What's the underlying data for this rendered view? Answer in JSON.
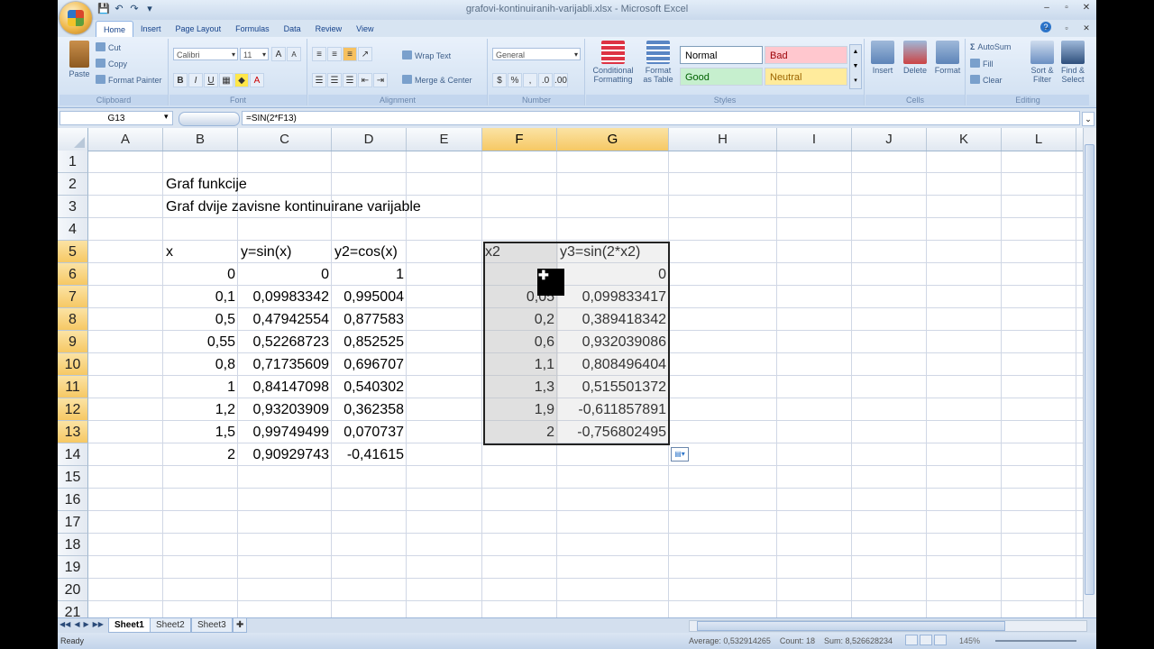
{
  "window": {
    "title": "grafovi-kontinuiranih-varijabli.xlsx - Microsoft Excel",
    "controls": [
      "‒",
      "▫",
      "✕"
    ]
  },
  "qat": {
    "save": "💾",
    "undo": "↶",
    "redo": "↷",
    "more": "▾"
  },
  "tabs": [
    "Home",
    "Insert",
    "Page Layout",
    "Formulas",
    "Data",
    "Review",
    "View"
  ],
  "active_tab": "Home",
  "ribbon": {
    "clipboard": {
      "label": "Clipboard",
      "paste": "Paste",
      "cut": "Cut",
      "copy": "Copy",
      "format_painter": "Format Painter"
    },
    "font": {
      "label": "Font",
      "font_name": "Calibri",
      "font_size": "11",
      "bold": "B",
      "italic": "I",
      "underline": "U",
      "grow": "A",
      "shrink": "A"
    },
    "alignment": {
      "label": "Alignment",
      "wrap_text": "Wrap Text",
      "merge_center": "Merge & Center"
    },
    "number": {
      "label": "Number",
      "format": "General",
      "currency": "$",
      "percent": "%",
      "comma": ","
    },
    "styles": {
      "label": "Styles",
      "conditional_formatting": "Conditional Formatting",
      "format_as_table": "Format as Table",
      "cells": [
        {
          "name": "Normal",
          "bg": "#ffffff",
          "color": "#000000"
        },
        {
          "name": "Bad",
          "bg": "#ffc7ce",
          "color": "#9c0006"
        },
        {
          "name": "Good",
          "bg": "#c6efce",
          "color": "#006100"
        },
        {
          "name": "Neutral",
          "bg": "#ffeb9c",
          "color": "#9c6500"
        }
      ]
    },
    "cells": {
      "label": "Cells",
      "insert": "Insert",
      "delete": "Delete",
      "format": "Format"
    },
    "editing": {
      "label": "Editing",
      "autosum": "AutoSum",
      "fill": "Fill",
      "clear": "Clear",
      "sort_filter": "Sort & Filter",
      "find_select": "Find & Select"
    }
  },
  "formula_bar": {
    "name_box": "G13",
    "formula": "=SIN(2*F13)"
  },
  "columns": [
    "A",
    "B",
    "C",
    "D",
    "E",
    "F",
    "G",
    "H",
    "I",
    "J",
    "K",
    "L"
  ],
  "selected_columns": [
    "F",
    "G"
  ],
  "rows": [
    "1",
    "2",
    "3",
    "4",
    "5",
    "6",
    "7",
    "8",
    "9",
    "10",
    "11",
    "12",
    "13",
    "14",
    "15",
    "16",
    "17",
    "18",
    "19",
    "20",
    "21"
  ],
  "selected_rows": [
    "5",
    "6",
    "7",
    "8",
    "9",
    "10",
    "11",
    "12",
    "13"
  ],
  "cells": {
    "B2": "Graf funkcije",
    "B3": "Graf dvije zavisne kontinuirane varijable",
    "B5": "x",
    "C5": "y=sin(x)",
    "D5": "y2=cos(x)",
    "F5": "x2",
    "G5": "y3=sin(2*x2)",
    "B6": "0",
    "C6": "0",
    "D6": "1",
    "G6": "0",
    "B7": "0,1",
    "C7": "0,09983342",
    "D7": "0,995004",
    "F7": "0,05",
    "G7": "0,099833417",
    "B8": "0,5",
    "C8": "0,47942554",
    "D8": "0,877583",
    "F8": "0,2",
    "G8": "0,389418342",
    "B9": "0,55",
    "C9": "0,52268723",
    "D9": "0,852525",
    "F9": "0,6",
    "G9": "0,932039086",
    "B10": "0,8",
    "C10": "0,71735609",
    "D10": "0,696707",
    "F10": "1,1",
    "G10": "0,808496404",
    "B11": "1",
    "C11": "0,84147098",
    "D11": "0,540302",
    "F11": "1,3",
    "G11": "0,515501372",
    "B12": "1,2",
    "C12": "0,93203909",
    "D12": "0,362358",
    "F12": "1,9",
    "G12": "-0,611857891",
    "B13": "1,5",
    "C13": "0,99749499",
    "D13": "0,070737",
    "F13": "2",
    "G13": "-0,756802495",
    "B14": "2",
    "C14": "0,90929743",
    "D14": "-0,41615"
  },
  "sheets": [
    "Sheet1",
    "Sheet2",
    "Sheet3"
  ],
  "active_sheet": "Sheet1",
  "status": {
    "ready": "Ready",
    "average": "Average: 0,532914265",
    "count": "Count: 18",
    "sum": "Sum: 8,526628234",
    "zoom": "145%"
  }
}
